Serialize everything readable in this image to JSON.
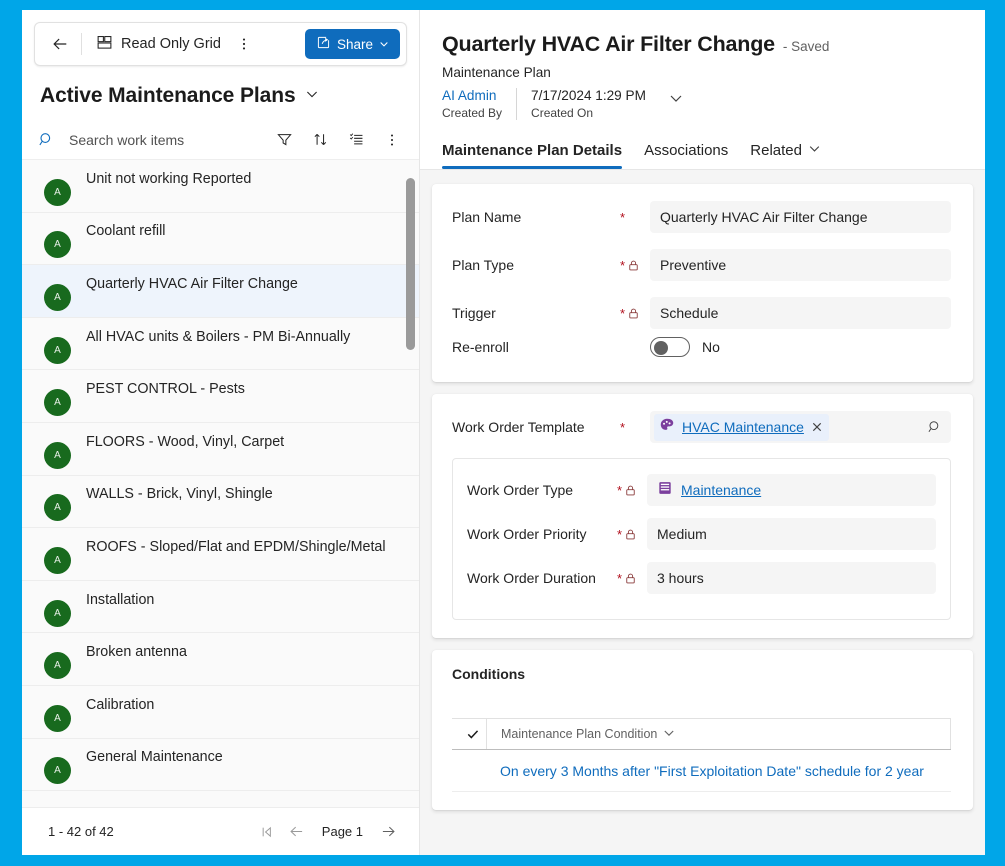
{
  "theme": {
    "border_blue": "#00a6e8",
    "accent_blue": "#0f6cbd",
    "avatar_green": "#186a1e",
    "required_red": "#b10e1c",
    "entity_purple": "#8764b8"
  },
  "left_panel": {
    "command_bar": {
      "back_label": "Back",
      "view_icon": "grid-icon",
      "view_label": "Read Only Grid",
      "more_label": "More commands",
      "share_label": "Share"
    },
    "view_selector": {
      "title": "Active Maintenance Plans",
      "chevron": "chevron-down-icon"
    },
    "search": {
      "icon": "search-icon",
      "placeholder": "Search work items",
      "value": "",
      "actions": [
        {
          "name": "filter-icon",
          "label": "Filter"
        },
        {
          "name": "sort-icon",
          "label": "Sort"
        },
        {
          "name": "edit-columns-icon",
          "label": "Edit columns"
        },
        {
          "name": "more-icon",
          "label": "More"
        }
      ]
    },
    "records": [
      {
        "initial": "A",
        "label": "Unit not working Reported",
        "selected": false
      },
      {
        "initial": "A",
        "label": "Coolant refill",
        "selected": false
      },
      {
        "initial": "A",
        "label": "Quarterly HVAC Air Filter Change",
        "selected": true
      },
      {
        "initial": "A",
        "label": "All HVAC units & Boilers - PM Bi-Annually",
        "selected": false
      },
      {
        "initial": "A",
        "label": "PEST CONTROL - Pests",
        "selected": false
      },
      {
        "initial": "A",
        "label": "FLOORS - Wood, Vinyl, Carpet",
        "selected": false
      },
      {
        "initial": "A",
        "label": "WALLS - Brick, Vinyl, Shingle",
        "selected": false
      },
      {
        "initial": "A",
        "label": "ROOFS - Sloped/Flat and EPDM/Shingle/Metal",
        "selected": false
      },
      {
        "initial": "A",
        "label": "Installation",
        "selected": false
      },
      {
        "initial": "A",
        "label": "Broken antenna",
        "selected": false
      },
      {
        "initial": "A",
        "label": "Calibration",
        "selected": false
      },
      {
        "initial": "A",
        "label": "General Maintenance",
        "selected": false
      }
    ],
    "pager": {
      "range": "1 - 42 of 42",
      "first_label": "First page",
      "prev_label": "Previous page",
      "page_label": "Page 1",
      "next_label": "Next page"
    }
  },
  "right_panel": {
    "record": {
      "title": "Quarterly HVAC Air Filter Change",
      "saved_state": "- Saved",
      "entity": "Maintenance Plan",
      "created_by_value": "AI Admin",
      "created_by_label": "Created By",
      "created_on_value": "7/17/2024 1:29 PM",
      "created_on_label": "Created On"
    },
    "tabs": [
      {
        "label": "Maintenance Plan Details",
        "active": true,
        "chevron": false
      },
      {
        "label": "Associations",
        "active": false,
        "chevron": false
      },
      {
        "label": "Related",
        "active": false,
        "chevron": true
      }
    ],
    "general_card": {
      "fields": [
        {
          "label": "Plan Name",
          "value": "Quarterly HVAC Air Filter Change",
          "required": true,
          "locked": false
        },
        {
          "label": "Plan Type",
          "value": "Preventive",
          "required": true,
          "locked": true
        },
        {
          "label": "Trigger",
          "value": "Schedule",
          "required": true,
          "locked": true
        }
      ],
      "toggle_field": {
        "label": "Re-enroll",
        "state_label": "No",
        "on": false
      }
    },
    "template_card": {
      "lookup": {
        "label": "Work Order Template",
        "required": true,
        "chip_icon": "palette-icon",
        "chip_label": "HVAC Maintenance",
        "remove_icon": "close-icon",
        "search_icon": "lookup-search-icon"
      },
      "sub_fields": [
        {
          "label": "Work Order Type",
          "value": "Maintenance",
          "required": true,
          "locked": true,
          "is_link": true,
          "icon": "form-entity-icon"
        },
        {
          "label": "Work Order Priority",
          "value": "Medium",
          "required": true,
          "locked": true,
          "is_link": false
        },
        {
          "label": "Work Order Duration",
          "value": "3 hours",
          "required": true,
          "locked": true,
          "is_link": false
        }
      ]
    },
    "conditions_card": {
      "title": "Conditions",
      "grid_header": {
        "check_icon": "checkmark-icon",
        "column_label": "Maintenance Plan Condition",
        "column_chevron": "chevron-down-icon"
      },
      "rows": [
        {
          "link": "On every 3 Months after \"First Exploitation Date\" schedule for 2 year"
        }
      ]
    }
  }
}
